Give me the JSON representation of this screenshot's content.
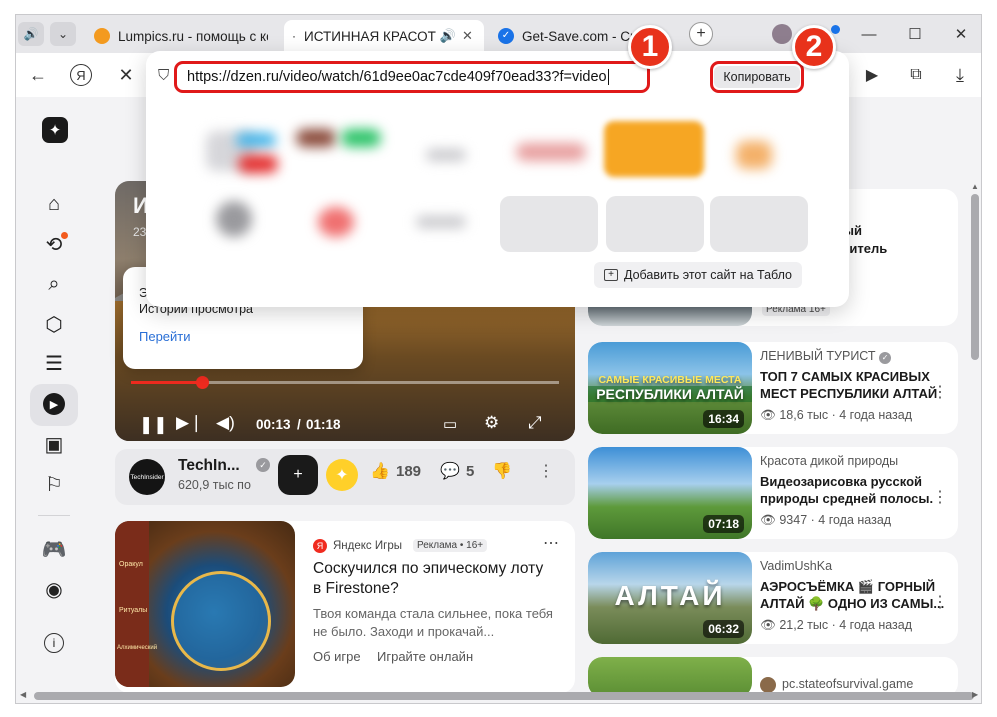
{
  "tabs": [
    {
      "title": "Lumpics.ru - помощь с ком",
      "fav_color": "#f39a1f"
    },
    {
      "title": "ИСТИННАЯ КРАСОТ",
      "active": true,
      "sound_icon": "speaker-icon"
    },
    {
      "title": "Get-Save.com - Ска",
      "fav_color": "#1a73e8"
    }
  ],
  "address": {
    "url": "https://dzen.ru/video/watch/61d9ee0ac7cde409f70ead33?f=video",
    "copy_label": "Копировать"
  },
  "badges": {
    "one": "1",
    "two": "2"
  },
  "omni": {
    "add_site_label": "Добавить этот сайт на Табло"
  },
  "toast": {
    "text": "Это видео сохранилось в Истории просмотра",
    "link": "Перейти"
  },
  "video": {
    "title_fragment": "И",
    "subtitle_fragment": "23",
    "time_current": "00:13",
    "time_total": "01:18",
    "progress": 0.165
  },
  "channel": {
    "name": "TechIn...",
    "subs": "620,9 тыс по",
    "avatar_text": "TechInsider",
    "likes": "189",
    "comments": "5"
  },
  "ad_card": {
    "source": "Яндекс Игры",
    "badge": "Реклама • 16+",
    "title": "Соскучился по эпическому лоту в Firestone?",
    "desc": "Твоя команда стала сильнее, пока тебя не было. Заходи и прокачай...",
    "link1": "Об игре",
    "link2": "Играйте онлайн",
    "thumb_labels": [
      "Оракул",
      "Ритуалы",
      "Алхимический"
    ]
  },
  "right_top": {
    "lines": [
      "анный",
      "акопитель",
      "M"
    ],
    "badge": "Реклама  16+"
  },
  "recs": [
    {
      "channel": "ЛЕНИВЫЙ ТУРИСТ",
      "verified": true,
      "title": "ТОП 7 САМЫХ КРАСИВЫХ МЕСТ РЕСПУБЛИКИ АЛТАЙ",
      "views": "18,6 тыс",
      "ago": "4 года назад",
      "duration": "16:34",
      "thumb_line1": "САМЫЕ КРАСИВЫЕ МЕСТА",
      "thumb_line2": "РЕСПУБЛИКИ АЛТАЙ"
    },
    {
      "channel": "Красота дикой природы",
      "verified": false,
      "title": "Видеозарисовка русской природы средней полосы.",
      "views": "9347",
      "ago": "4 года назад",
      "duration": "07:18"
    },
    {
      "channel": "VadimUshKa",
      "verified": false,
      "title": "АЭРОСЪЁМКА 🎬 ГОРНЫЙ АЛТАЙ 🌳 ОДНО ИЗ САМЫ...",
      "views": "21,2 тыс",
      "ago": "4 года назад",
      "duration": "06:32",
      "thumb_line1": "АЛТАЙ"
    },
    {
      "channel": "pc.stateofsurvival.game",
      "verified": false,
      "title": "",
      "views": "",
      "ago": "",
      "duration": ""
    }
  ]
}
